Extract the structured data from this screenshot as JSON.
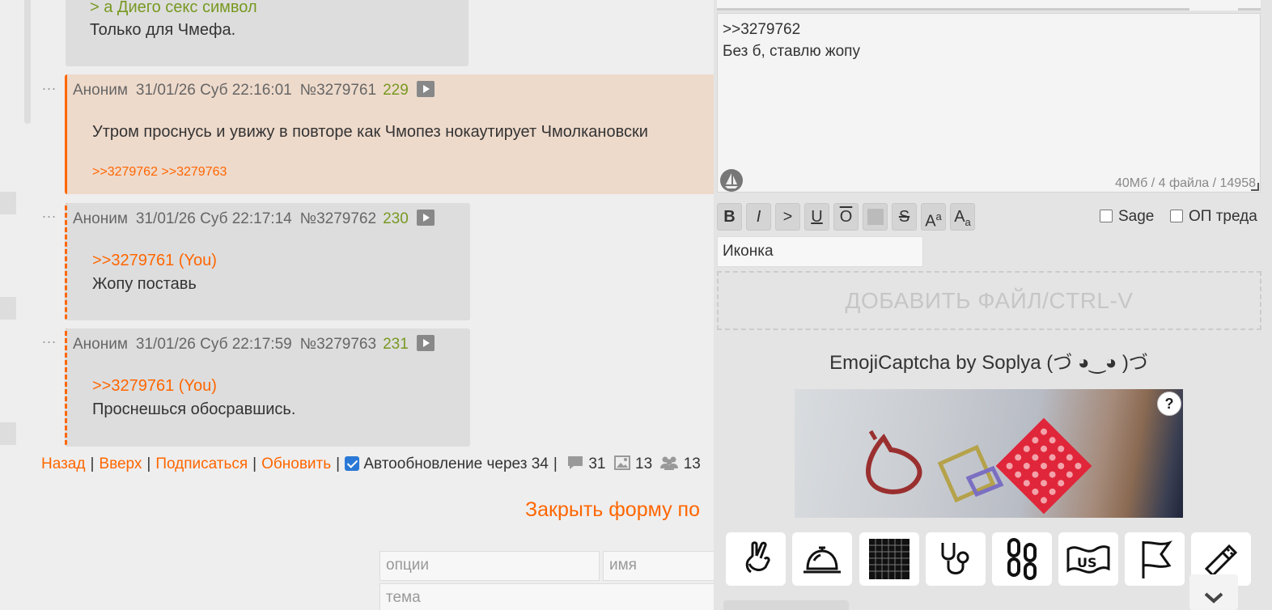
{
  "posts": [
    {
      "quote": "> а Диего секс символ",
      "text": "Только для Чмефа."
    },
    {
      "author": "Аноним",
      "datetime": "31/01/26 Суб 22:16:01",
      "id": "№3279761",
      "count": "229",
      "text": "Утром проснусь и увижу в повторе как Чмопез нокаутирует Чмолкановски",
      "refs": ">>3279762 >>3279763"
    },
    {
      "author": "Аноним",
      "datetime": "31/01/26 Суб 22:17:14",
      "id": "№3279762",
      "count": "230",
      "reply": ">>3279761 (You)",
      "text": "Жопу поставь"
    },
    {
      "author": "Аноним",
      "datetime": "31/01/26 Суб 22:17:59",
      "id": "№3279763",
      "count": "231",
      "reply": ">>3279761 (You)",
      "text": "Проснешься обосравшись."
    }
  ],
  "dots": "...",
  "nav": {
    "back": "Назад",
    "up": "Вверх",
    "subscribe": "Подписаться",
    "refresh": "Обновить",
    "sep": "|",
    "autoupdate": "Автообновление через 34",
    "posts_count": "31",
    "images_count": "13",
    "users_count": "13"
  },
  "close_form": "Закрыть форму по",
  "bottom_form": {
    "options_placeholder": "опции",
    "name_placeholder": "имя",
    "subject_placeholder": "тема"
  },
  "reply_form": {
    "message": ">>3279762\nБез б, ставлю жопу",
    "limits": "40Мб / 4 файла / 14958",
    "toolbar": {
      "bold": "B",
      "italic": "I",
      "quote": ">",
      "underline": "U",
      "overline": "O",
      "spoiler": "",
      "strike": "S",
      "sup_a": "A",
      "sup_b": "a",
      "sub_a": "A",
      "sub_b": "a"
    },
    "sage_label": "Sage",
    "op_label": "ОП треда",
    "icon_field": "Иконка",
    "drop_label": "ДОБАВИТЬ ФАЙЛ/CTRL-V",
    "captcha_title": "EmojiCaptcha by Soplya (づ ◕‿◕ )づ",
    "captcha_help": "?",
    "emoji_buttons": [
      "crossed-fingers-icon",
      "service-bell-icon",
      "grid-pattern-icon",
      "stethoscope-icon",
      "chain-icon",
      "us-flag-icon",
      "flag-icon",
      "usb-stick-icon"
    ]
  },
  "colors": {
    "accent": "#ff6600",
    "quote": "#789922",
    "post_bg": "#dddddd",
    "highlight_bg": "#eedacb"
  }
}
